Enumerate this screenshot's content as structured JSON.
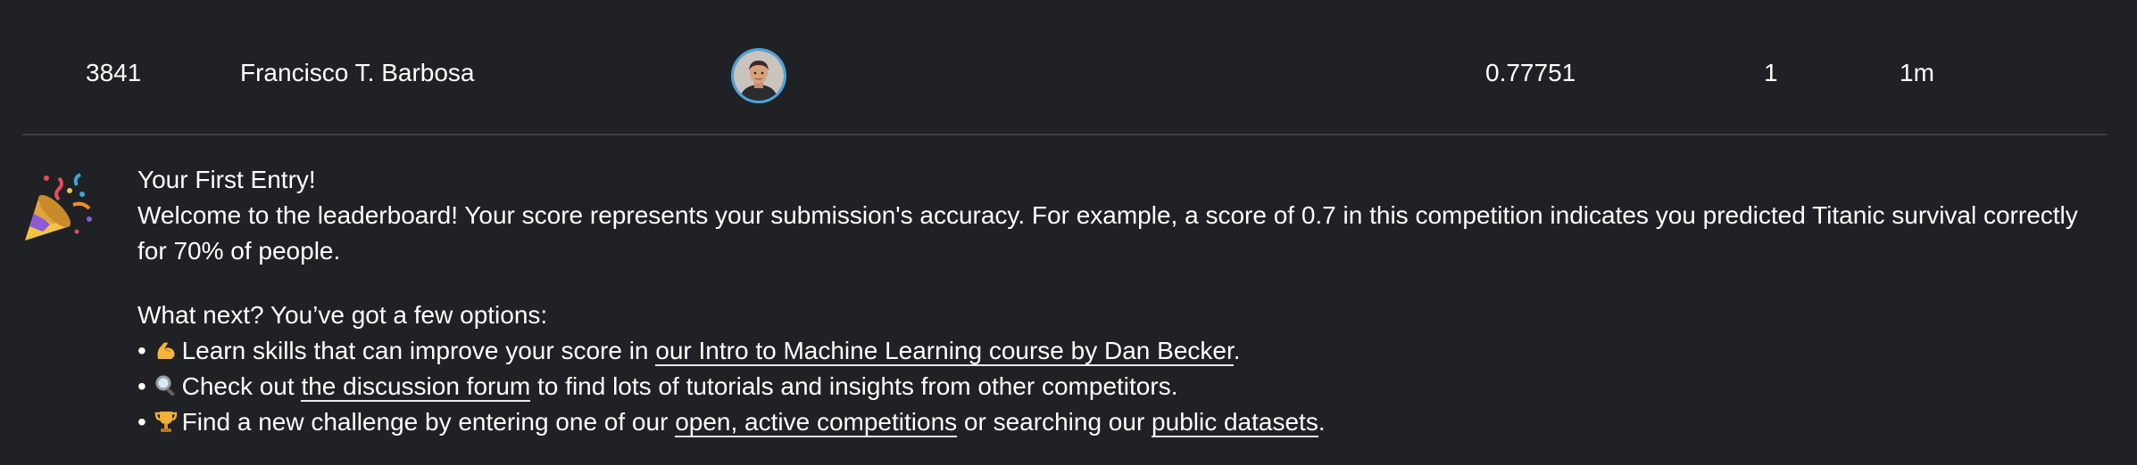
{
  "leaderboard_row": {
    "rank": "3841",
    "team_name": "Francisco T. Barbosa",
    "avatar": "user-avatar",
    "score": "0.77751",
    "entries": "1",
    "last": "1m"
  },
  "first_entry": {
    "icon": "party-popper-icon",
    "title": "Your First Entry!",
    "welcome_text": "Welcome to the leaderboard! Your score represents your submission's accuracy. For example, a score of 0.7 in this competition indicates you predicted Titanic survival correctly for 70% of people.",
    "next_heading": "What next? You’ve got a few options:",
    "options": [
      {
        "icon": "flexed-biceps-icon",
        "before": "Learn skills that can improve your score in ",
        "link": "our Intro to Machine Learning course by Dan Becker",
        "after": "."
      },
      {
        "icon": "magnifying-glass-icon",
        "before": "Check out ",
        "link": "the discussion forum",
        "after": " to find lots of tutorials and insights from other competitors."
      },
      {
        "icon": "trophy-icon",
        "before": "Find a new challenge by entering one of our ",
        "link": "open, active competitions",
        "middle": " or searching our ",
        "link2": "public datasets",
        "after": "."
      }
    ],
    "bullet": "•"
  },
  "colors": {
    "background": "#202124",
    "text": "#ffffff",
    "divider": "#3c4043",
    "avatar_ring": "#4aa3df"
  }
}
